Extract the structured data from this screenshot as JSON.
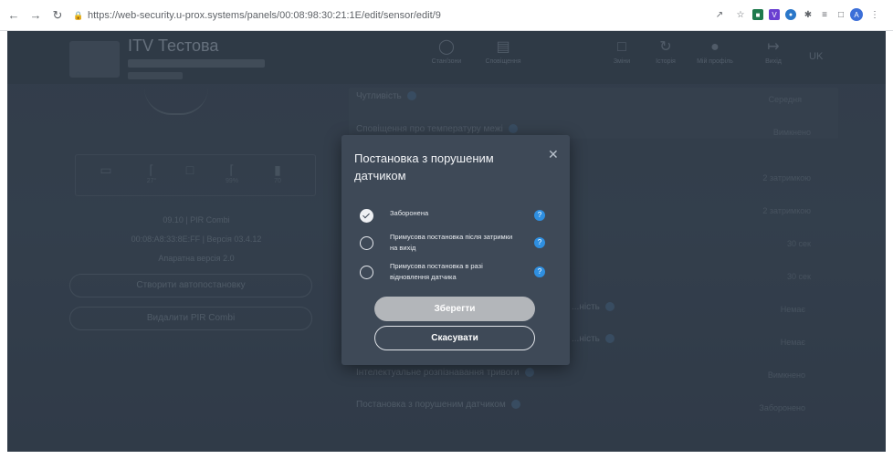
{
  "browser": {
    "url": "https://web-security.u-prox.systems/panels/00:08:98:30:21:1E/edit/sensor/edit/9"
  },
  "app": {
    "title": "ITV Тестова",
    "nav": [
      {
        "label": "Стан/зони"
      },
      {
        "label": "Сповіщення"
      },
      {
        "label": "Зміни"
      },
      {
        "label": "Історія"
      },
      {
        "label": "Мій профіль"
      },
      {
        "label": "Вихід"
      }
    ],
    "lang": "UK"
  },
  "device": {
    "metric_values": [
      "27°",
      "99%",
      "70"
    ],
    "id_line": "09.10 | PIR Combi",
    "mac_line": "00:08:A8:33:8E:FF | Версія 03.4.12",
    "hw_line": "Апаратна версія 2.0",
    "btn_disabled": "Створити автопостановку",
    "btn_delete": "Видалити PIR Combi"
  },
  "settings": {
    "rows": [
      {
        "label": "Чутливість",
        "value": "Середня"
      },
      {
        "label": "Сповіщення про температуру межі",
        "value": "Вимкнено"
      },
      {
        "label": "",
        "value": "2 затримкою"
      },
      {
        "label": "",
        "value": "2 затримкою"
      },
      {
        "label": "",
        "value": "30 сек"
      },
      {
        "label": "",
        "value": "30 сек"
      },
      {
        "label": "...ність",
        "value": "Немає"
      },
      {
        "label": "...ність",
        "value": "Немає"
      },
      {
        "label": "Інтелектуальне розпізнавання тривоги",
        "value": "Вимкнено"
      },
      {
        "label": "Постановка з порушеним датчиком",
        "value": "Заборонено"
      }
    ]
  },
  "modal": {
    "title": "Постановка з порушеним датчиком",
    "options": [
      {
        "label": "Заборонена",
        "checked": true
      },
      {
        "label": "Примусова постановка після затримки на вихід",
        "checked": false
      },
      {
        "label": "Примусова постановка в разі відновлення датчика",
        "checked": false
      }
    ],
    "help_icon": "?",
    "save_label": "Зберегти",
    "cancel_label": "Скасувати"
  }
}
